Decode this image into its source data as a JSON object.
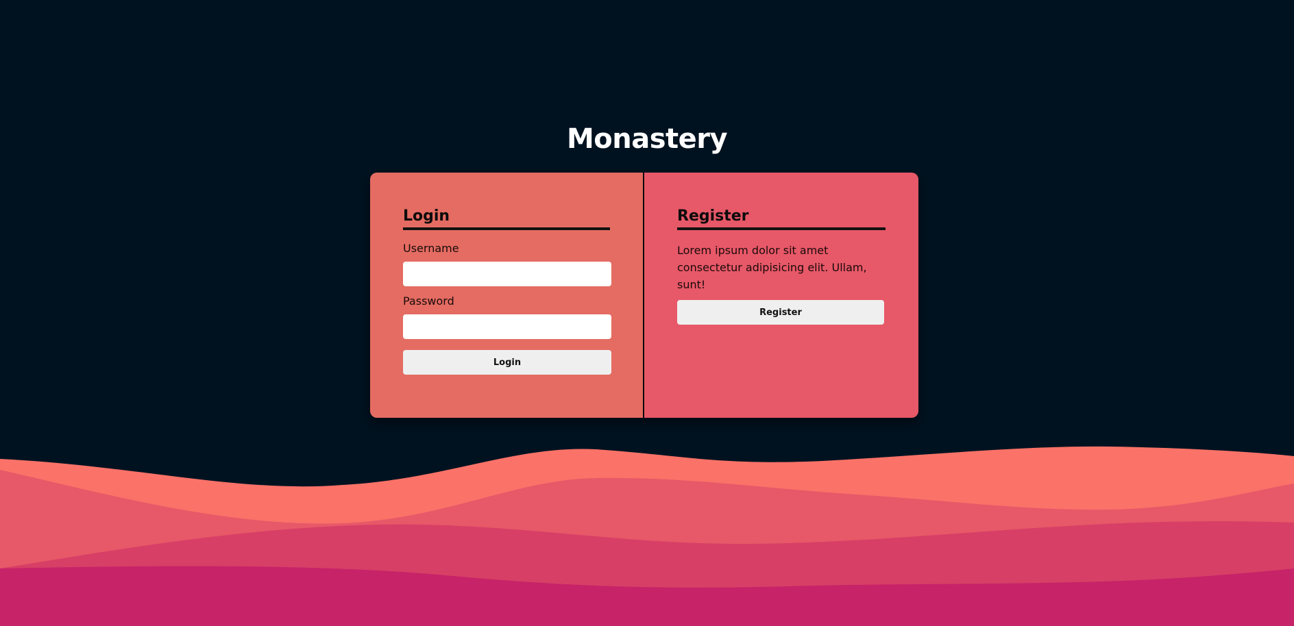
{
  "site": {
    "title": "Monastery"
  },
  "login": {
    "heading": "Login",
    "username_label": "Username",
    "username_value": "",
    "password_label": "Password",
    "password_value": "",
    "button_label": "Login"
  },
  "register": {
    "heading": "Register",
    "description": "Lorem ipsum dolor sit amet consectetur adipisicing elit. Ullam, sunt!",
    "button_label": "Register"
  },
  "colors": {
    "background": "#001220",
    "login_panel": "#e46c62",
    "register_panel": "#e75868",
    "wave_1": "#fa7268",
    "wave_2": "#e75868",
    "wave_3": "#d73f66",
    "wave_4": "#c62368",
    "button": "#efefef"
  }
}
